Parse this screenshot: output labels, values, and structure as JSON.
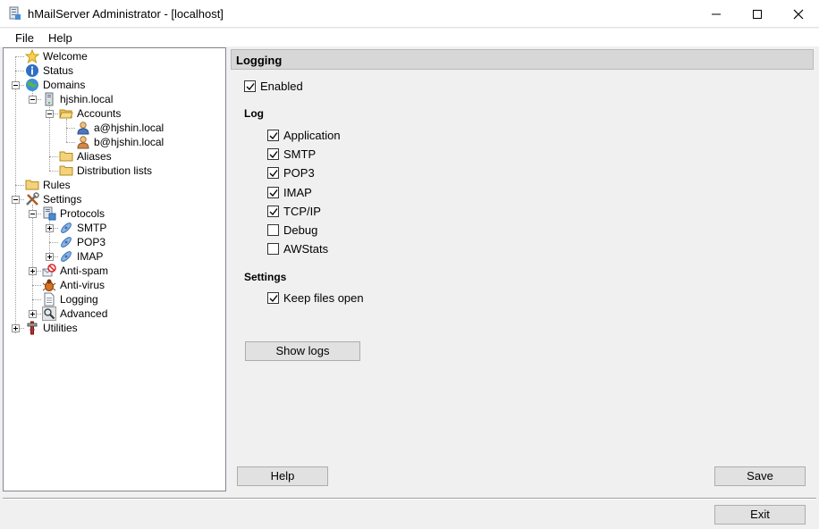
{
  "window": {
    "title": "hMailServer Administrator - [localhost]"
  },
  "menu": {
    "file": "File",
    "help": "Help"
  },
  "tree": {
    "welcome": "Welcome",
    "status": "Status",
    "domains": "Domains",
    "domain": "hjshin.local",
    "accounts": "Accounts",
    "account_a": "a@hjshin.local",
    "account_b": "b@hjshin.local",
    "aliases": "Aliases",
    "distribution_lists": "Distribution lists",
    "rules": "Rules",
    "settings": "Settings",
    "protocols": "Protocols",
    "smtp": "SMTP",
    "pop3": "POP3",
    "imap": "IMAP",
    "antispam": "Anti-spam",
    "antivirus": "Anti-virus",
    "logging": "Logging",
    "advanced": "Advanced",
    "utilities": "Utilities"
  },
  "panel": {
    "header": "Logging",
    "enabled": {
      "label": "Enabled",
      "checked": true
    },
    "log_group": "Log",
    "log_options": [
      {
        "label": "Application",
        "checked": true
      },
      {
        "label": "SMTP",
        "checked": true
      },
      {
        "label": "POP3",
        "checked": true
      },
      {
        "label": "IMAP",
        "checked": true
      },
      {
        "label": "TCP/IP",
        "checked": true
      },
      {
        "label": "Debug",
        "checked": false
      },
      {
        "label": "AWStats",
        "checked": false
      }
    ],
    "settings_group": "Settings",
    "keep_files_open": {
      "label": "Keep files open",
      "checked": true
    },
    "show_logs_button": "Show logs"
  },
  "buttons": {
    "help": "Help",
    "save": "Save",
    "exit": "Exit"
  }
}
